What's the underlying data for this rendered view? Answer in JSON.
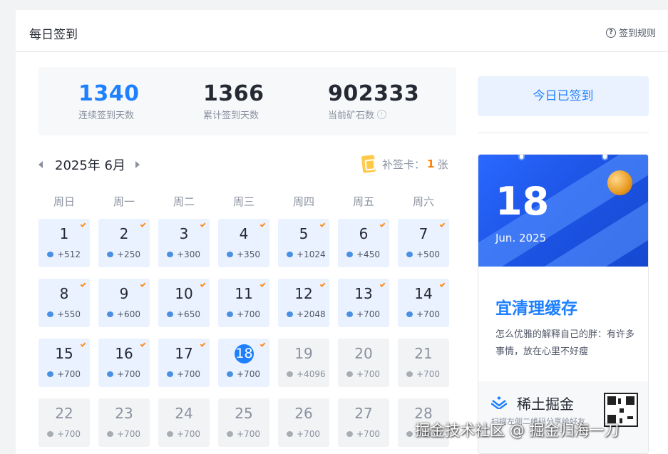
{
  "header": {
    "title": "每日签到",
    "rules_label": "签到规则",
    "rules_icon": "question-circle-icon"
  },
  "stats": [
    {
      "value": "1340",
      "label": "连续签到天数"
    },
    {
      "value": "1366",
      "label": "累计签到天数"
    },
    {
      "value": "902333",
      "label": "当前矿石数"
    }
  ],
  "calendar": {
    "month_label": "2025年 6月",
    "makeup": {
      "label": "补签卡：",
      "count": "1",
      "unit": "张"
    },
    "weekdays": [
      "周日",
      "周一",
      "周二",
      "周三",
      "周四",
      "周五",
      "周六"
    ],
    "days": [
      {
        "day": "1",
        "reward": "+512",
        "state": "signed"
      },
      {
        "day": "2",
        "reward": "+250",
        "state": "signed"
      },
      {
        "day": "3",
        "reward": "+300",
        "state": "signed"
      },
      {
        "day": "4",
        "reward": "+350",
        "state": "signed"
      },
      {
        "day": "5",
        "reward": "+1024",
        "state": "signed"
      },
      {
        "day": "6",
        "reward": "+450",
        "state": "signed"
      },
      {
        "day": "7",
        "reward": "+500",
        "state": "signed"
      },
      {
        "day": "8",
        "reward": "+550",
        "state": "signed"
      },
      {
        "day": "9",
        "reward": "+600",
        "state": "signed"
      },
      {
        "day": "10",
        "reward": "+650",
        "state": "signed"
      },
      {
        "day": "11",
        "reward": "+700",
        "state": "signed"
      },
      {
        "day": "12",
        "reward": "+2048",
        "state": "signed"
      },
      {
        "day": "13",
        "reward": "+700",
        "state": "signed"
      },
      {
        "day": "14",
        "reward": "+700",
        "state": "signed"
      },
      {
        "day": "15",
        "reward": "+700",
        "state": "signed"
      },
      {
        "day": "16",
        "reward": "+700",
        "state": "signed"
      },
      {
        "day": "17",
        "reward": "+700",
        "state": "signed"
      },
      {
        "day": "18",
        "reward": "+700",
        "state": "today"
      },
      {
        "day": "19",
        "reward": "+4096",
        "state": "future"
      },
      {
        "day": "20",
        "reward": "+700",
        "state": "future"
      },
      {
        "day": "21",
        "reward": "+700",
        "state": "future"
      },
      {
        "day": "22",
        "reward": "+700",
        "state": "future"
      },
      {
        "day": "23",
        "reward": "+700",
        "state": "future"
      },
      {
        "day": "24",
        "reward": "+700",
        "state": "future"
      },
      {
        "day": "25",
        "reward": "+700",
        "state": "future"
      },
      {
        "day": "26",
        "reward": "+700",
        "state": "future"
      },
      {
        "day": "27",
        "reward": "+700",
        "state": "future"
      },
      {
        "day": "28",
        "reward": "+700",
        "state": "future"
      }
    ]
  },
  "sidebar": {
    "signed_button": "今日已签到",
    "calendar_card": {
      "day": "18",
      "month_year": "Jun. 2025",
      "title": "宜清理缓存",
      "text": "怎么优雅的解释自己的胖：有许多事情，放在心里不好瘦",
      "brand": "稀土掘金",
      "scan_text": "扫描左侧二维码分享给好友"
    }
  },
  "watermark": "掘金技术社区 @ 掘金归海一刀",
  "colors": {
    "accent": "#1e80ff",
    "signed_bg": "#eaf2ff",
    "future_bg": "#f2f3f5",
    "check": "#ff8c1a"
  }
}
